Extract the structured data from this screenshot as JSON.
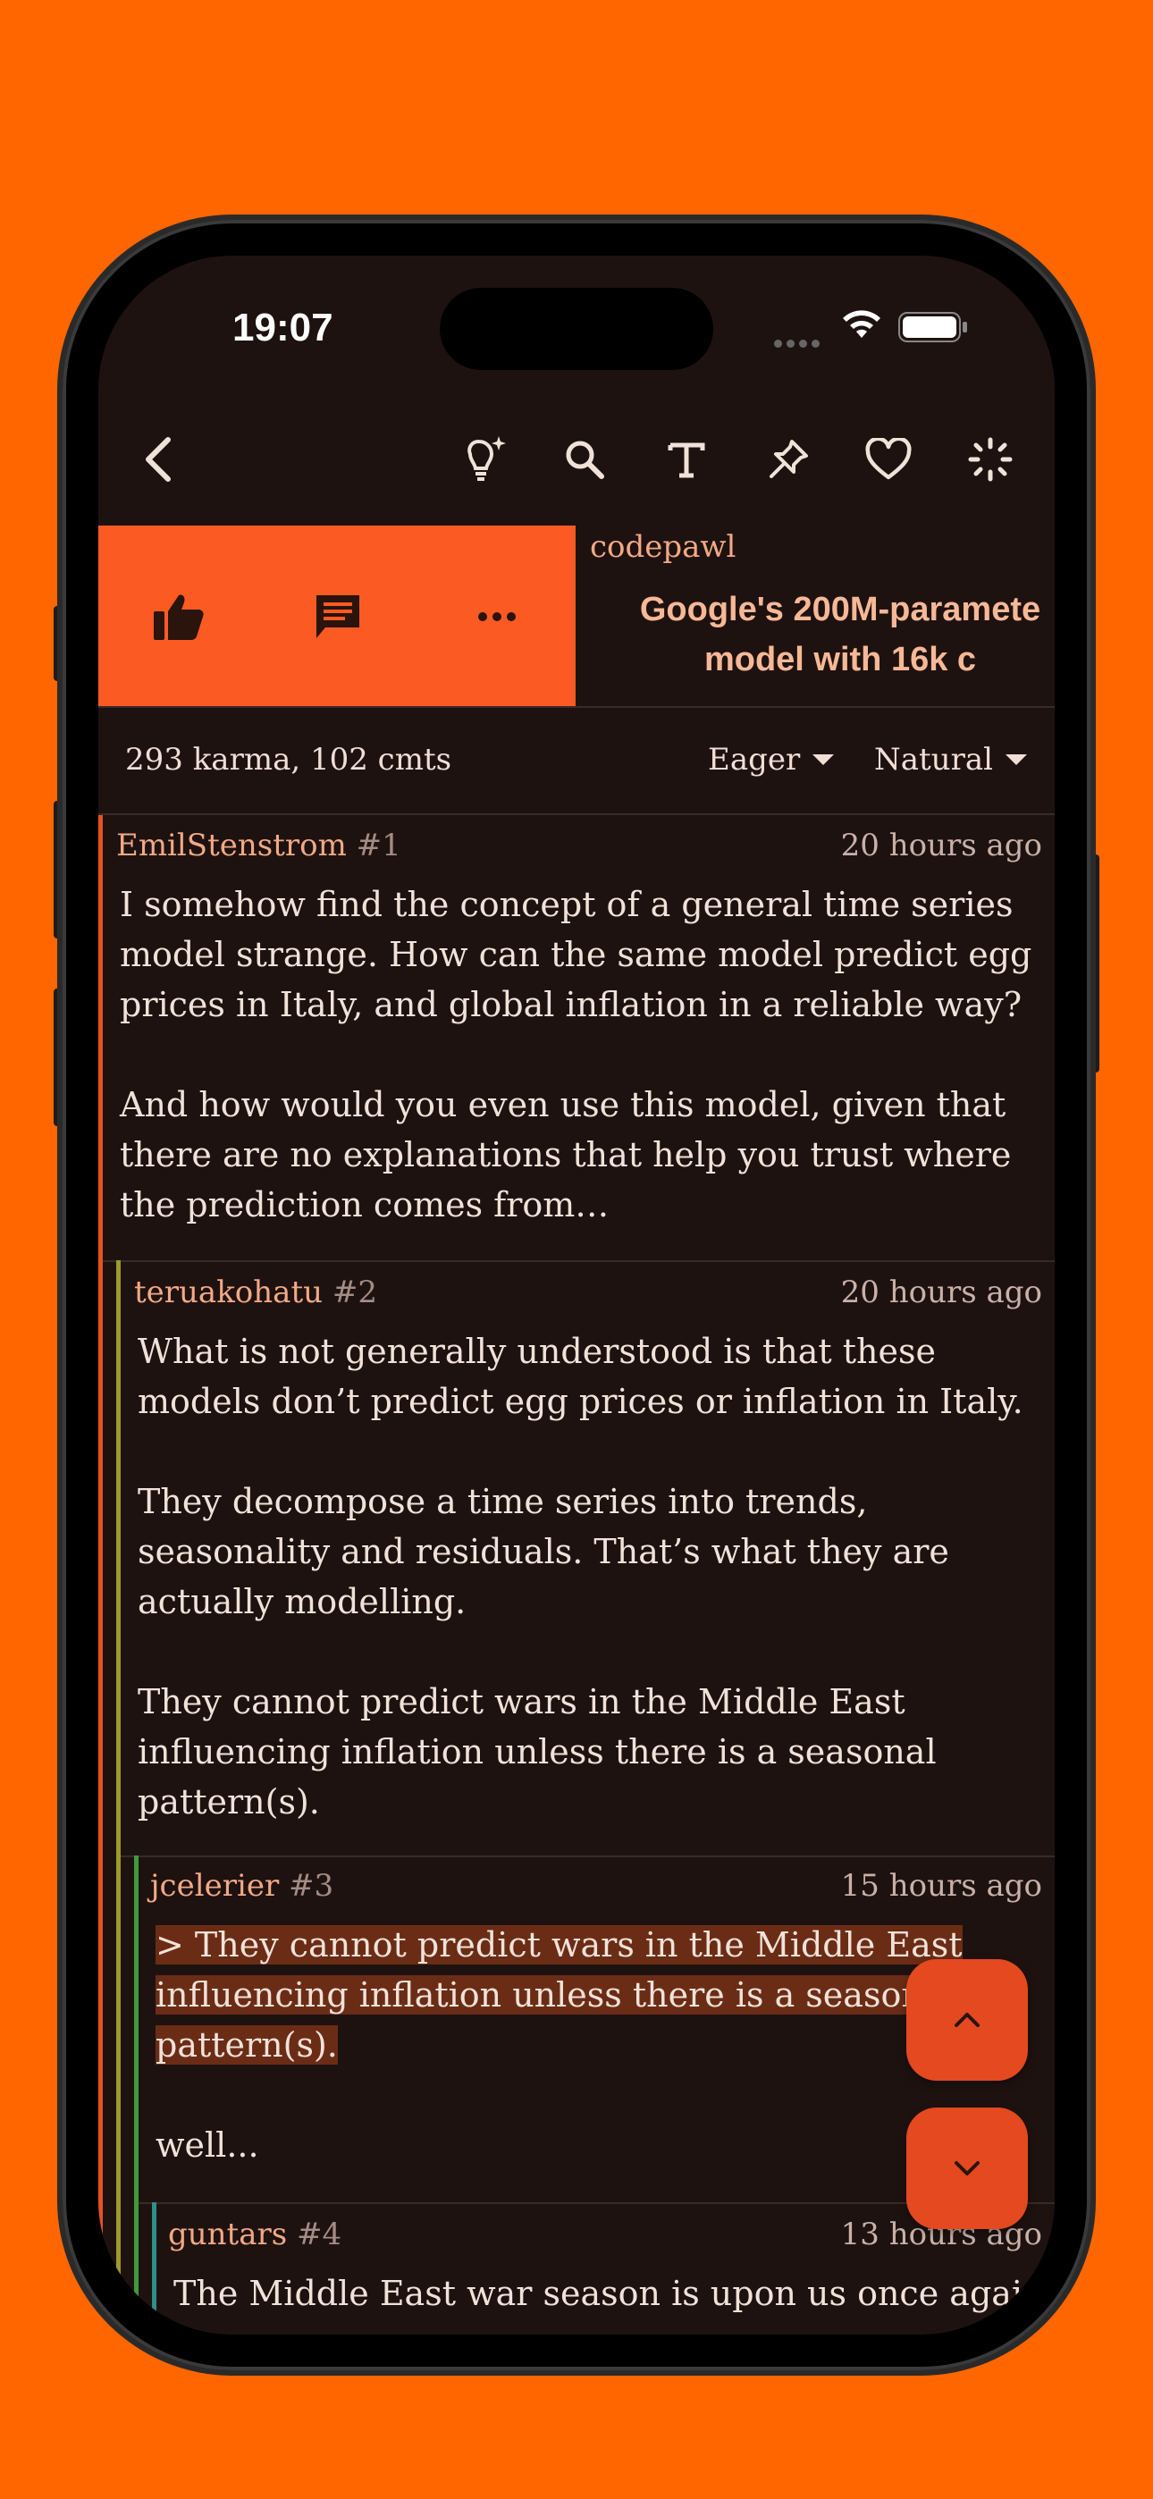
{
  "status_bar": {
    "time": "19:07"
  },
  "colors": {
    "accent": "#fb5a23",
    "background": "#1e1210",
    "page_bg": "#ff6600"
  },
  "nav": {
    "icons": [
      "back-chevron-icon",
      "idea-bulb-icon",
      "search-icon",
      "text-size-icon",
      "pin-icon",
      "heart-icon",
      "loading-spinner-icon"
    ]
  },
  "post": {
    "author": "codepawl",
    "title_line1": "Google's 200M-paramete",
    "title_line2": "model with 16k c",
    "actions": [
      "thumbs-up-icon",
      "comment-icon",
      "more-icon"
    ]
  },
  "meta": {
    "karma_comments": "293 karma, 102 cmts",
    "load_mode": "Eager",
    "sort_mode": "Natural"
  },
  "comments": [
    {
      "user": "EmilStenstrom",
      "index": "#1",
      "time": "20 hours ago",
      "body": "I somehow find the concept of a general time series\nmodel strange. How can the same model predict egg\nprices in Italy, and global inflation in a reliable way?\n\nAnd how would you even use this model, given that\nthere are no explanations that help you trust where\nthe prediction comes from…"
    },
    {
      "user": "teruakohatu",
      "index": "#2",
      "time": "20 hours ago",
      "body": "What is not generally understood is that these\nmodels don’t predict egg prices or inflation in Italy.\n\nThey decompose a time series into trends,\nseasonality and residuals. That’s what they are\nactually modelling.\n\nThey cannot predict wars in the Middle East\ninfluencing inflation unless there is a seasonal\npattern(s)."
    },
    {
      "user": "jcelerier",
      "index": "#3",
      "time": "15 hours ago",
      "quote_line1": "> They cannot predict wars in the Middle East",
      "quote_line2": "influencing inflation unless there is a seasonal",
      "quote_line3": "pattern(s).",
      "body": "well..."
    },
    {
      "user": "guntars",
      "index": "#4",
      "time": "13 hours ago",
      "body": "The Middle East war season is upon us once again"
    }
  ],
  "fab": {
    "up": "chevron-up-icon",
    "down": "chevron-down-icon"
  }
}
